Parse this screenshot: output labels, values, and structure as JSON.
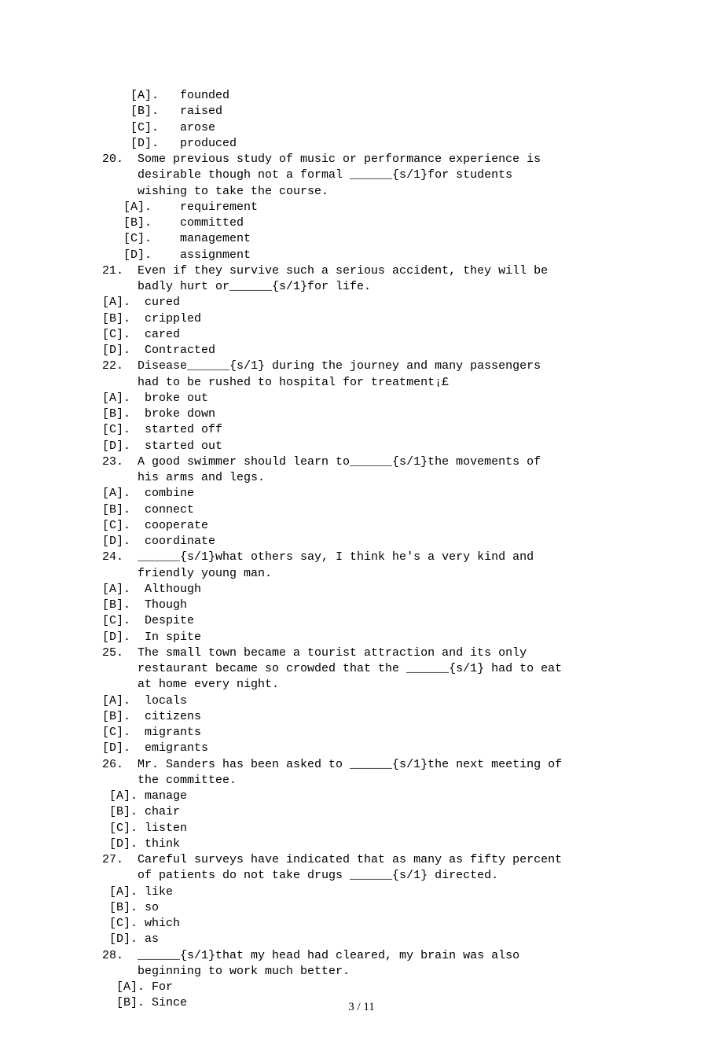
{
  "lines": {
    "l0": "    [A].   founded",
    "l1": "    [B].   raised",
    "l2": "    [C].   arose",
    "l3": "    [D].   produced",
    "l4": "20.  Some previous study of music or performance experience is",
    "l5": "     desirable though not a formal ______{s/1}for students",
    "l6": "     wishing to take the course.",
    "l7": "   [A].    requirement",
    "l8": "   [B].    committed",
    "l9": "   [C].    management",
    "l10": "   [D].    assignment",
    "l11": "21.  Even if they survive such a serious accident, they will be",
    "l12": "     badly hurt or______{s/1}for life.",
    "l13": "[A].  cured",
    "l14": "[B].  crippled",
    "l15": "[C].  cared",
    "l16": "[D].  Contracted",
    "l17": "22.  Disease______{s/1} during the journey and many passengers",
    "l18": "     had to be rushed to hospital for treatment¡£",
    "l19": "[A].  broke out",
    "l20": "[B].  broke down",
    "l21": "[C].  started off",
    "l22": "[D].  started out",
    "l23": "23.  A good swimmer should learn to______{s/1}the movements of",
    "l24": "     his arms and legs.",
    "l25": "[A].  combine",
    "l26": "[B].  connect",
    "l27": "[C].  cooperate",
    "l28": "[D].  coordinate",
    "l29": "24.  ______{s/1}what others say, I think he's a very kind and",
    "l30": "     friendly young man.",
    "l31": "[A].  Although",
    "l32": "[B].  Though",
    "l33": "[C].  Despite",
    "l34": "[D].  In spite",
    "l35": "25.  The small town became a tourist attraction and its only",
    "l36": "     restaurant became so crowded that the ______{s/1} had to eat",
    "l37": "     at home every night.",
    "l38": "[A].  locals",
    "l39": "[B].  citizens",
    "l40": "[C].  migrants",
    "l41": "[D].  emigrants",
    "l42": "26.  Mr. Sanders has been asked to ______{s/1}the next meeting of",
    "l43": "     the committee.",
    "l44": " [A]. manage",
    "l45": " [B]. chair",
    "l46": " [C]. listen",
    "l47": " [D]. think",
    "l48": "27.  Careful surveys have indicated that as many as fifty percent",
    "l49": "     of patients do not take drugs ______{s/1} directed.",
    "l50": " [A]. like",
    "l51": " [B]. so",
    "l52": " [C]. which",
    "l53": " [D]. as",
    "l54": "28.  ______{s/1}that my head had cleared, my brain was also",
    "l55": "     beginning to work much better.",
    "l56": "  [A]. For",
    "l57": "  [B]. Since"
  },
  "footer": "3 / 11"
}
